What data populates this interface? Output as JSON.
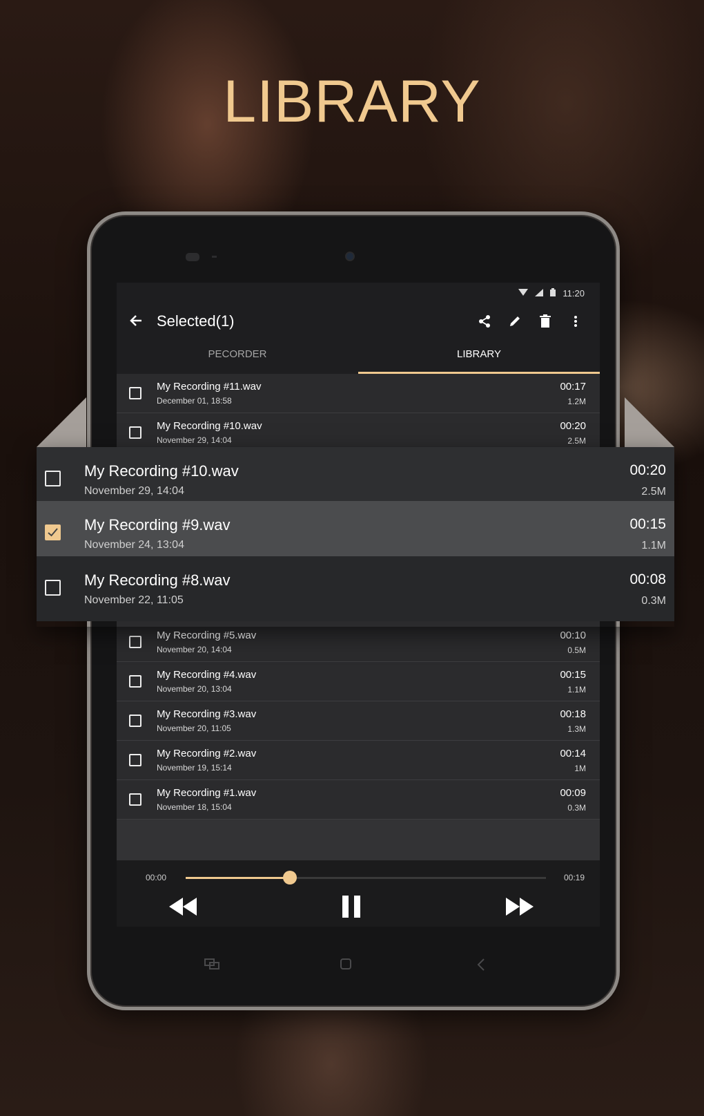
{
  "promo": {
    "title": "LIBRARY"
  },
  "status": {
    "time": "11:20"
  },
  "toolbar": {
    "title": "Selected(1)"
  },
  "tabs": [
    {
      "label": "PECORDER",
      "active": false
    },
    {
      "label": "LIBRARY",
      "active": true
    }
  ],
  "list_top": [
    {
      "name": "My Recording   #11.wav",
      "date": "December 01, 18:58",
      "duration": "00:17",
      "size": "1.2M",
      "checked": false
    },
    {
      "name": "My Recording   #10.wav",
      "date": "November 29, 14:04",
      "duration": "00:20",
      "size": "2.5M",
      "checked": false
    }
  ],
  "overlay": [
    {
      "name": "My Recording   #10.wav",
      "date": "November 29, 14:04",
      "duration": "00:20",
      "size": "2.5M",
      "checked": false
    },
    {
      "name": "My Recording   #9.wav",
      "date": "November 24, 13:04",
      "duration": "00:15",
      "size": "1.1M",
      "checked": true
    },
    {
      "name": "My Recording   #8.wav",
      "date": "November 22, 11:05",
      "duration": "00:08",
      "size": "0.3M",
      "checked": false
    }
  ],
  "list_bottom": [
    {
      "name": "My Recording   #5.wav",
      "date": "November 20, 14:04",
      "duration": "00:10",
      "size": "0.5M",
      "checked": false
    },
    {
      "name": "My Recording   #4.wav",
      "date": "November 20, 13:04",
      "duration": "00:15",
      "size": "1.1M",
      "checked": false
    },
    {
      "name": "My Recording   #3.wav",
      "date": "November 20, 11:05",
      "duration": "00:18",
      "size": "1.3M",
      "checked": false
    },
    {
      "name": "My Recording   #2.wav",
      "date": "November 19, 15:14",
      "duration": "00:14",
      "size": "1M",
      "checked": false
    },
    {
      "name": "My Recording   #1.wav",
      "date": "November 18, 15:04",
      "duration": "00:09",
      "size": "0.3M",
      "checked": false
    }
  ],
  "player": {
    "current": "00:00",
    "total": "00:19",
    "progress": 0.29
  },
  "colors": {
    "accent": "#f0c98f",
    "surface": "#2b2b2d",
    "bar": "#1e1e20"
  },
  "icons": [
    "back-arrow-icon",
    "share-icon",
    "pencil-icon",
    "trash-icon",
    "more-vert-icon",
    "rewind-icon",
    "pause-icon",
    "fast-forward-icon",
    "recents-icon",
    "home-icon",
    "nav-back-icon",
    "wifi-icon",
    "signal-icon",
    "battery-icon"
  ]
}
